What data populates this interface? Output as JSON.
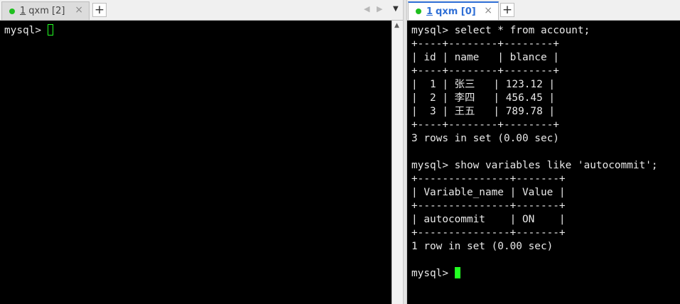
{
  "left_pane": {
    "tab": {
      "number": "1",
      "title": "qxm [2]",
      "close": "×"
    },
    "add_tab": "+",
    "nav": {
      "prev": "◀",
      "next": "▶",
      "dropdown": "▼"
    },
    "prompt": "mysql> "
  },
  "right_pane": {
    "tab": {
      "number": "1",
      "title": "qxm [0]",
      "close": "×"
    },
    "add_tab": "+",
    "output": "mysql> select * from account;\n+----+--------+--------+\n| id | name   | blance |\n+----+--------+--------+\n|  1 | 张三   | 123.12 |\n|  2 | 李四   | 456.45 |\n|  3 | 王五   | 789.78 |\n+----+--------+--------+\n3 rows in set (0.00 sec)\n\nmysql> show variables like 'autocommit';\n+---------------+-------+\n| Variable_name | Value |\n+---------------+-------+\n| autocommit    | ON    |\n+---------------+-------+\n1 row in set (0.00 sec)\n\n",
    "prompt": "mysql> "
  },
  "scrollbar": {
    "up_arrow": "▲"
  },
  "colors": {
    "terminal_bg": "#000000",
    "terminal_fg": "#e8e8e8",
    "cursor": "#22ff22",
    "active_tab_accent": "#2f6fd6",
    "tab_dot": "#1fbf1f"
  }
}
